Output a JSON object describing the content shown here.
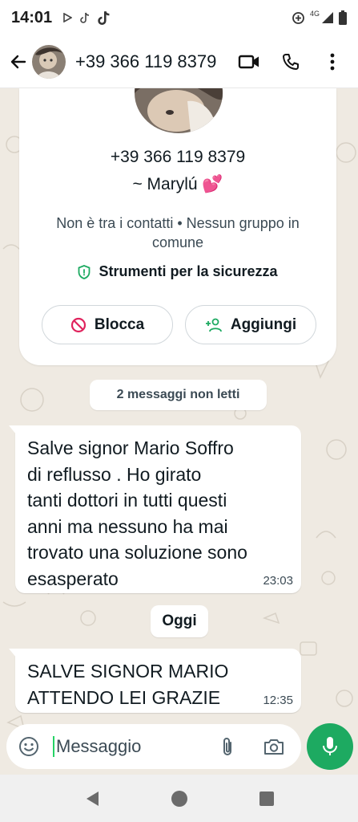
{
  "status_bar": {
    "time": "14:01",
    "network": "4G"
  },
  "header": {
    "title": "+39 366 119 8379"
  },
  "contact_card": {
    "phone": "+39 366 119 8379",
    "name": "~ Marylú 💕",
    "subtitle": "Non è tra i contatti • Nessun gruppo in comune",
    "safety_label": "Strumenti per la sicurezza",
    "block_label": "Blocca",
    "add_label": "Aggiungi"
  },
  "unread_label": "2 messaggi non letti",
  "day_separator": "Oggi",
  "messages": [
    {
      "text": "Salve signor Mario Soffro\ndi reflusso . Ho girato\ntanti dottori in tutti questi\nanni ma nessuno ha mai\ntrovato una soluzione sono\nesasperato",
      "time": "23:03"
    },
    {
      "text": "SALVE SIGNOR MARIO\nATTENDO LEI GRAZIE",
      "time": "12:35"
    }
  ],
  "composer": {
    "placeholder": "Messaggio"
  },
  "colors": {
    "accent": "#1daa61",
    "block": "#e0245e",
    "add": "#1daa61",
    "safety": "#1daa61"
  },
  "icons": [
    "back-arrow-icon",
    "video-call-icon",
    "voice-call-icon",
    "more-vert-icon",
    "shield-check-icon",
    "block-icon",
    "add-person-icon",
    "emoji-icon",
    "attach-icon",
    "camera-icon",
    "mic-icon"
  ]
}
